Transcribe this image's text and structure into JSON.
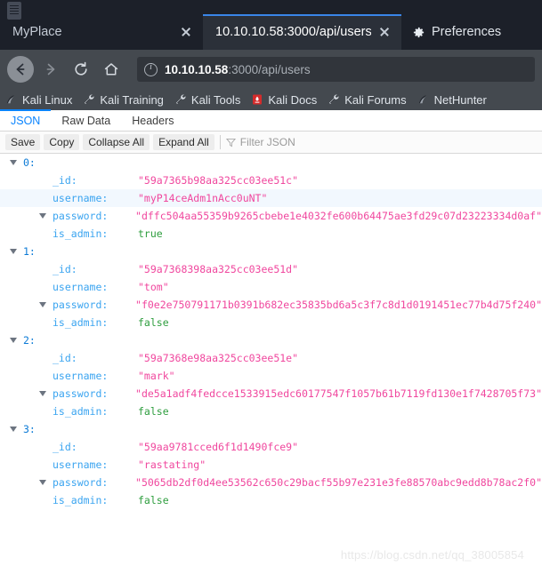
{
  "window": {
    "tabs": [
      {
        "title": "MyPlace",
        "active": false,
        "close_label": "close-tab"
      },
      {
        "title": "10.10.10.58:3000/api/users",
        "active": true,
        "close_label": "close-tab"
      }
    ],
    "preferences_tab": {
      "label": "Preferences",
      "icon": "gear-icon"
    }
  },
  "nav": {
    "back": "back-arrow-icon",
    "forward": "forward-arrow-icon",
    "reload": "reload-icon",
    "home": "home-icon",
    "url_host": "10.10.10.58",
    "url_rest": ":3000/api/users",
    "identity_icon": "info-circle-icon"
  },
  "bookmarks": [
    {
      "label": "Kali Linux",
      "icon": "kali-dragon-icon"
    },
    {
      "label": "Kali Training",
      "icon": "kali-wrench-icon"
    },
    {
      "label": "Kali Tools",
      "icon": "kali-wrench-icon"
    },
    {
      "label": "Kali Docs",
      "icon": "kali-docs-book-icon"
    },
    {
      "label": "Kali Forums",
      "icon": "kali-wrench-icon"
    },
    {
      "label": "NetHunter",
      "icon": "kali-dragon-icon"
    }
  ],
  "viewer": {
    "tabs": [
      {
        "label": "JSON",
        "selected": true
      },
      {
        "label": "Raw Data",
        "selected": false
      },
      {
        "label": "Headers",
        "selected": false
      }
    ],
    "toolbar": {
      "save": "Save",
      "copy": "Copy",
      "collapse_all": "Collapse All",
      "expand_all": "Expand All",
      "filter_placeholder": "Filter JSON",
      "filter_value": "",
      "filter_icon": "funnel-icon"
    },
    "colors": {
      "key": "#3aa4f0",
      "index": "#0b7ad6",
      "string": "#f0479e",
      "boolean": "#2f9e3f",
      "accent": "#0a84ff",
      "row_highlight": "#f2f8fe"
    }
  },
  "json_records": [
    {
      "index": "0:",
      "fields": [
        {
          "key": "_id:",
          "value": "\"59a7365b98aa325cc03ee51c\"",
          "type": "string",
          "expandable": false
        },
        {
          "key": "username:",
          "value": "\"myP14ceAdm1nAcc0uNT\"",
          "type": "string",
          "expandable": false,
          "highlight": true
        },
        {
          "key": "password:",
          "value": "\"dffc504aa55359b9265cbebe1e4032fe600b64475ae3fd29c07d23223334d0af\"",
          "type": "string",
          "expandable": true
        },
        {
          "key": "is_admin:",
          "value": "true",
          "type": "boolean",
          "expandable": false
        }
      ]
    },
    {
      "index": "1:",
      "fields": [
        {
          "key": "_id:",
          "value": "\"59a7368398aa325cc03ee51d\"",
          "type": "string",
          "expandable": false
        },
        {
          "key": "username:",
          "value": "\"tom\"",
          "type": "string",
          "expandable": false
        },
        {
          "key": "password:",
          "value": "\"f0e2e750791171b0391b682ec35835bd6a5c3f7c8d1d0191451ec77b4d75f240\"",
          "type": "string",
          "expandable": true
        },
        {
          "key": "is_admin:",
          "value": "false",
          "type": "boolean",
          "expandable": false
        }
      ]
    },
    {
      "index": "2:",
      "fields": [
        {
          "key": "_id:",
          "value": "\"59a7368e98aa325cc03ee51e\"",
          "type": "string",
          "expandable": false
        },
        {
          "key": "username:",
          "value": "\"mark\"",
          "type": "string",
          "expandable": false
        },
        {
          "key": "password:",
          "value": "\"de5a1adf4fedcce1533915edc60177547f1057b61b7119fd130e1f7428705f73\"",
          "type": "string",
          "expandable": true
        },
        {
          "key": "is_admin:",
          "value": "false",
          "type": "boolean",
          "expandable": false
        }
      ]
    },
    {
      "index": "3:",
      "fields": [
        {
          "key": "_id:",
          "value": "\"59aa9781cced6f1d1490fce9\"",
          "type": "string",
          "expandable": false
        },
        {
          "key": "username:",
          "value": "\"rastating\"",
          "type": "string",
          "expandable": false
        },
        {
          "key": "password:",
          "value": "\"5065db2df0d4ee53562c650c29bacf55b97e231e3fe88570abc9edd8b78ac2f0\"",
          "type": "string",
          "expandable": true
        },
        {
          "key": "is_admin:",
          "value": "false",
          "type": "boolean",
          "expandable": false
        }
      ]
    }
  ],
  "watermark": "https://blog.csdn.net/qq_38005854"
}
